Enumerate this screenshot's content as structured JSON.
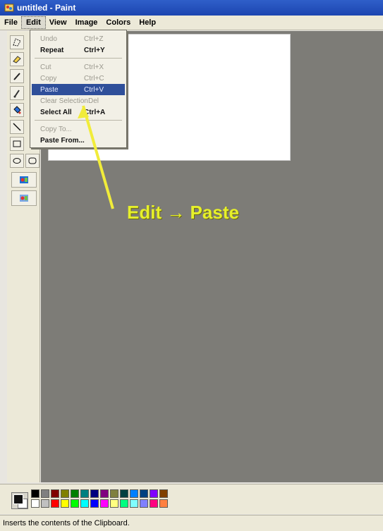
{
  "window": {
    "title": "untitled - Paint"
  },
  "menubar": {
    "items": [
      "File",
      "Edit",
      "View",
      "Image",
      "Colors",
      "Help"
    ],
    "active": "Edit"
  },
  "edit_menu": {
    "items": [
      {
        "label": "Undo",
        "shortcut": "Ctrl+Z",
        "state": "disabled"
      },
      {
        "label": "Repeat",
        "shortcut": "Ctrl+Y",
        "state": "enabled"
      },
      {
        "label": "Cut",
        "shortcut": "Ctrl+X",
        "state": "disabled"
      },
      {
        "label": "Copy",
        "shortcut": "Ctrl+C",
        "state": "disabled"
      },
      {
        "label": "Paste",
        "shortcut": "Ctrl+V",
        "state": "highlighted"
      },
      {
        "label": "Clear Selection",
        "shortcut": "Del",
        "state": "disabled"
      },
      {
        "label": "Select All",
        "shortcut": "Ctrl+A",
        "state": "enabled"
      },
      {
        "label": "Copy To...",
        "shortcut": "",
        "state": "disabled"
      },
      {
        "label": "Paste From...",
        "shortcut": "",
        "state": "enabled"
      }
    ]
  },
  "annotation": {
    "text": "Edit → Paste",
    "color": "#e6f02a"
  },
  "palette": {
    "foreground": "#111111",
    "background": "#ffffff",
    "colors_top": [
      "#000000",
      "#808080",
      "#800000",
      "#808000",
      "#008000",
      "#008080",
      "#000080",
      "#800080",
      "#808040",
      "#004040",
      "#0080ff",
      "#004080",
      "#8000ff",
      "#804000"
    ],
    "colors_bottom": [
      "#ffffff",
      "#c0c0c0",
      "#ff0000",
      "#ffff00",
      "#00ff00",
      "#00ffff",
      "#0000ff",
      "#ff00ff",
      "#ffff80",
      "#00ff80",
      "#80ffff",
      "#8080ff",
      "#ff0080",
      "#ff8040"
    ]
  },
  "statusbar": {
    "text": "Inserts the contents of the Clipboard."
  }
}
